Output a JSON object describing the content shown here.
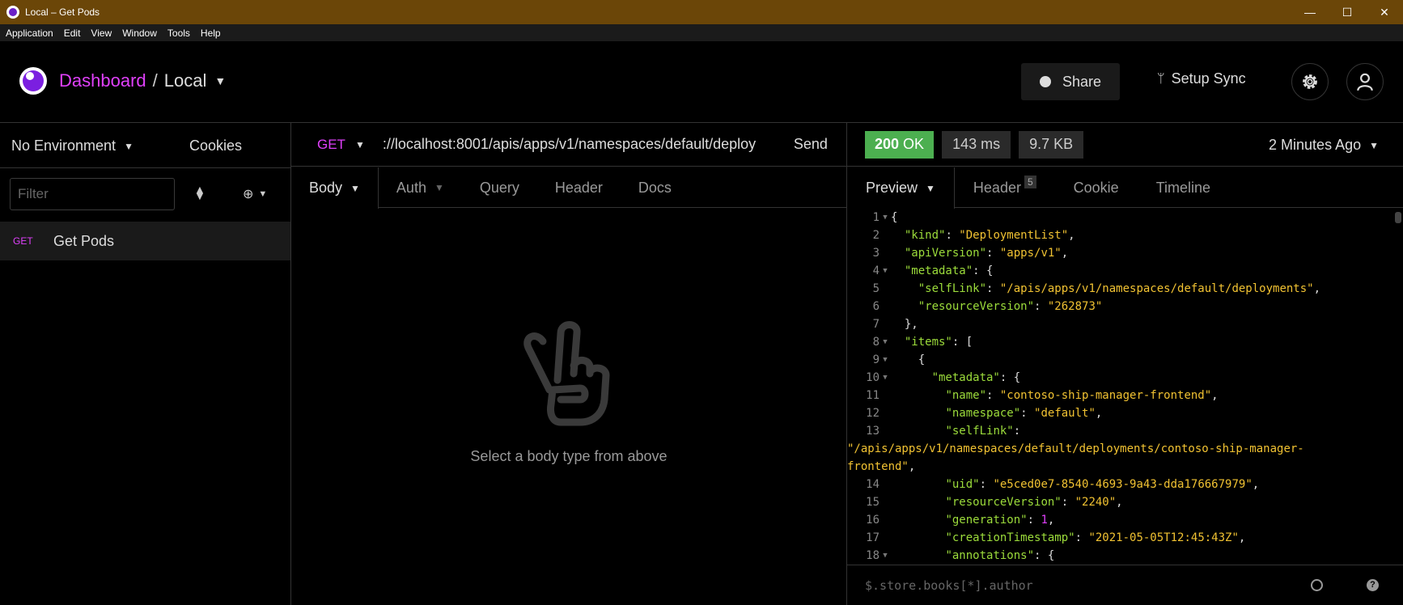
{
  "window": {
    "title": "Local – Get Pods",
    "controls": {
      "minimize": "—",
      "maximize": "☐",
      "close": "✕"
    }
  },
  "menu": [
    "Application",
    "Edit",
    "View",
    "Window",
    "Tools",
    "Help"
  ],
  "header": {
    "dashboard": "Dashboard",
    "separator": "/",
    "workspace": "Local",
    "share_label": "Share",
    "sync_label": "Setup Sync"
  },
  "sidebar": {
    "environment": "No Environment",
    "cookies": "Cookies",
    "filter_placeholder": "Filter",
    "requests": [
      {
        "method": "GET",
        "name": "Get Pods"
      }
    ]
  },
  "request": {
    "method": "GET",
    "url": "://localhost:8001/apis/apps/v1/namespaces/default/deploy",
    "send": "Send",
    "tabs": [
      "Body",
      "Auth",
      "Query",
      "Header",
      "Docs"
    ],
    "empty_message": "Select a body type from above"
  },
  "response": {
    "status_code": "200",
    "status_text": "OK",
    "time": "143 ms",
    "size": "9.7 KB",
    "time_ago": "2 Minutes Ago",
    "tabs": [
      "Preview",
      "Header",
      "Cookie",
      "Timeline"
    ],
    "header_count": "5",
    "filter_placeholder": "$.store.books[*].author"
  },
  "code_lines": [
    {
      "n": "1",
      "fold": true,
      "tokens": [
        [
          "p",
          "{"
        ]
      ]
    },
    {
      "n": "2",
      "fold": false,
      "tokens": [
        [
          "p",
          "  "
        ],
        [
          "k",
          "\"kind\""
        ],
        [
          "p",
          ": "
        ],
        [
          "s",
          "\"DeploymentList\""
        ],
        [
          "p",
          ","
        ]
      ]
    },
    {
      "n": "3",
      "fold": false,
      "tokens": [
        [
          "p",
          "  "
        ],
        [
          "k",
          "\"apiVersion\""
        ],
        [
          "p",
          ": "
        ],
        [
          "s",
          "\"apps/v1\""
        ],
        [
          "p",
          ","
        ]
      ]
    },
    {
      "n": "4",
      "fold": true,
      "tokens": [
        [
          "p",
          "  "
        ],
        [
          "k",
          "\"metadata\""
        ],
        [
          "p",
          ": {"
        ]
      ]
    },
    {
      "n": "5",
      "fold": false,
      "tokens": [
        [
          "p",
          "    "
        ],
        [
          "k",
          "\"selfLink\""
        ],
        [
          "p",
          ": "
        ],
        [
          "s",
          "\"/apis/apps/v1/namespaces/default/deployments\""
        ],
        [
          "p",
          ","
        ]
      ]
    },
    {
      "n": "6",
      "fold": false,
      "tokens": [
        [
          "p",
          "    "
        ],
        [
          "k",
          "\"resourceVersion\""
        ],
        [
          "p",
          ": "
        ],
        [
          "s",
          "\"262873\""
        ]
      ]
    },
    {
      "n": "7",
      "fold": false,
      "tokens": [
        [
          "p",
          "  },"
        ]
      ]
    },
    {
      "n": "8",
      "fold": true,
      "tokens": [
        [
          "p",
          "  "
        ],
        [
          "k",
          "\"items\""
        ],
        [
          "p",
          ": ["
        ]
      ]
    },
    {
      "n": "9",
      "fold": true,
      "tokens": [
        [
          "p",
          "    {"
        ]
      ]
    },
    {
      "n": "10",
      "fold": true,
      "tokens": [
        [
          "p",
          "      "
        ],
        [
          "k",
          "\"metadata\""
        ],
        [
          "p",
          ": {"
        ]
      ]
    },
    {
      "n": "11",
      "fold": false,
      "tokens": [
        [
          "p",
          "        "
        ],
        [
          "k",
          "\"name\""
        ],
        [
          "p",
          ": "
        ],
        [
          "s",
          "\"contoso-ship-manager-frontend\""
        ],
        [
          "p",
          ","
        ]
      ]
    },
    {
      "n": "12",
      "fold": false,
      "tokens": [
        [
          "p",
          "        "
        ],
        [
          "k",
          "\"namespace\""
        ],
        [
          "p",
          ": "
        ],
        [
          "s",
          "\"default\""
        ],
        [
          "p",
          ","
        ]
      ]
    },
    {
      "n": "13",
      "fold": false,
      "tokens": [
        [
          "p",
          "        "
        ],
        [
          "k",
          "\"selfLink\""
        ],
        [
          "p",
          ":"
        ]
      ]
    },
    {
      "n": "",
      "fold": false,
      "wrap": true,
      "tokens": [
        [
          "s",
          "\"/apis/apps/v1/namespaces/default/deployments/contoso-ship-manager-"
        ]
      ]
    },
    {
      "n": "",
      "fold": false,
      "wrap": true,
      "tokens": [
        [
          "s",
          "frontend\""
        ],
        [
          "p",
          ","
        ]
      ]
    },
    {
      "n": "14",
      "fold": false,
      "tokens": [
        [
          "p",
          "        "
        ],
        [
          "k",
          "\"uid\""
        ],
        [
          "p",
          ": "
        ],
        [
          "s",
          "\"e5ced0e7-8540-4693-9a43-dda176667979\""
        ],
        [
          "p",
          ","
        ]
      ]
    },
    {
      "n": "15",
      "fold": false,
      "tokens": [
        [
          "p",
          "        "
        ],
        [
          "k",
          "\"resourceVersion\""
        ],
        [
          "p",
          ": "
        ],
        [
          "s",
          "\"2240\""
        ],
        [
          "p",
          ","
        ]
      ]
    },
    {
      "n": "16",
      "fold": false,
      "tokens": [
        [
          "p",
          "        "
        ],
        [
          "k",
          "\"generation\""
        ],
        [
          "p",
          ": "
        ],
        [
          "n",
          "1"
        ],
        [
          "p",
          ","
        ]
      ]
    },
    {
      "n": "17",
      "fold": false,
      "tokens": [
        [
          "p",
          "        "
        ],
        [
          "k",
          "\"creationTimestamp\""
        ],
        [
          "p",
          ": "
        ],
        [
          "s",
          "\"2021-05-05T12:45:43Z\""
        ],
        [
          "p",
          ","
        ]
      ]
    },
    {
      "n": "18",
      "fold": true,
      "tokens": [
        [
          "p",
          "        "
        ],
        [
          "k",
          "\"annotations\""
        ],
        [
          "p",
          ": {"
        ]
      ]
    }
  ]
}
